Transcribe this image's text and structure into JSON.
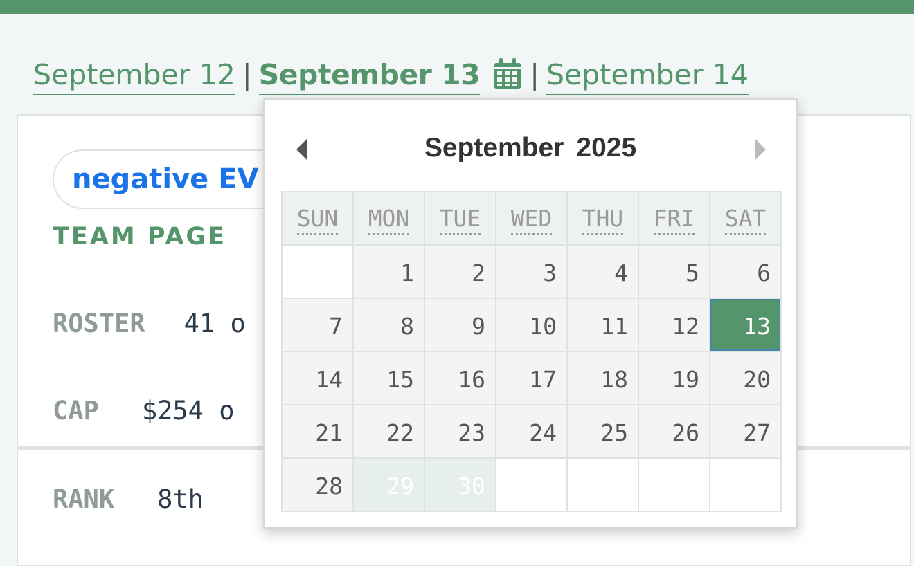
{
  "date_nav": {
    "prev_label": "September 12",
    "separator": "|",
    "current_label": "September 13",
    "next_label": "September 14",
    "calendar_icon": "calendar-icon"
  },
  "team": {
    "ev_label": "negative EV",
    "team_page_label": "TEAM PAGE",
    "roster_label": "ROSTER",
    "roster_value": "41 o",
    "cap_label": "CAP",
    "cap_value": "$254 o",
    "rank_label": "RANK",
    "rank_value": "8th"
  },
  "datepicker": {
    "month": "September",
    "year": "2025",
    "prev_icon": "caret-left-icon",
    "next_icon": "caret-right-icon",
    "weekdays": [
      "SUN",
      "MON",
      "TUE",
      "WED",
      "THU",
      "FRI",
      "SAT"
    ],
    "weeks": [
      [
        "",
        "1",
        "2",
        "3",
        "4",
        "5",
        "6"
      ],
      [
        "7",
        "8",
        "9",
        "10",
        "11",
        "12",
        "13"
      ],
      [
        "14",
        "15",
        "16",
        "17",
        "18",
        "19",
        "20"
      ],
      [
        "21",
        "22",
        "23",
        "24",
        "25",
        "26",
        "27"
      ],
      [
        "28",
        "29",
        "30",
        "",
        "",
        "",
        ""
      ]
    ],
    "selected": "13",
    "disabled_future": [
      "29",
      "30"
    ]
  },
  "colors": {
    "brand_green": "#55956c",
    "link_blue": "#1a73e8"
  }
}
